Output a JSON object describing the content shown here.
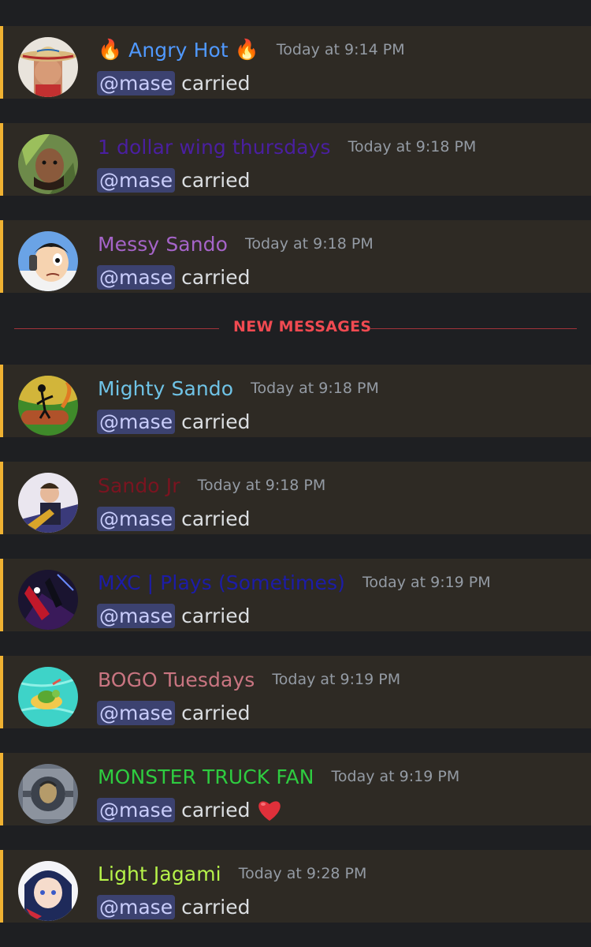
{
  "divider": {
    "label": "NEW MESSAGES"
  },
  "messages": [
    {
      "name": "Angry Hot",
      "name_color": "#5099ff",
      "prefix_emoji": "🔥",
      "suffix_emoji": "🔥",
      "timestamp": "Today at 9:14 PM",
      "mention": "@mase",
      "text": "carried",
      "avatar_icon": "cowboy-hat-avatar-icon"
    },
    {
      "name": "1 dollar wing thursdays",
      "name_color": "#4a1fa0",
      "timestamp": "Today at 9:18 PM",
      "mention": "@mase",
      "text": "carried",
      "avatar_icon": "upside-down-face-avatar-icon"
    },
    {
      "name": "Messy Sando",
      "name_color": "#a564c8",
      "timestamp": "Today at 9:18 PM",
      "mention": "@mase",
      "text": "carried",
      "avatar_icon": "cartoon-phone-avatar-icon"
    },
    {
      "name": "Mighty Sando",
      "name_color": "#6fc3e6",
      "timestamp": "Today at 9:18 PM",
      "mention": "@mase",
      "text": "carried",
      "avatar_icon": "jungle-stickman-avatar-icon"
    },
    {
      "name": "Sando Jr",
      "name_color": "#7a1420",
      "timestamp": "Today at 9:18 PM",
      "mention": "@mase",
      "text": "carried",
      "avatar_icon": "saxophone-avatar-icon"
    },
    {
      "name": "MXC | Plays (Sometimes)",
      "name_color": "#1c1ca8",
      "timestamp": "Today at 9:19 PM",
      "mention": "@mase",
      "text": "carried",
      "avatar_icon": "spider-hero-avatar-icon"
    },
    {
      "name": "BOGO Tuesdays",
      "name_color": "#c97581",
      "timestamp": "Today at 9:19 PM",
      "mention": "@mase",
      "text": "carried",
      "avatar_icon": "turtle-float-avatar-icon"
    },
    {
      "name": "MONSTER TRUCK FAN",
      "name_color": "#2ecc40",
      "timestamp": "Today at 9:19 PM",
      "mention": "@mase",
      "text": "carried",
      "trailing_icon": "red-heart-icon",
      "avatar_icon": "robot-pilot-avatar-icon"
    },
    {
      "name": "Light Jagami",
      "name_color": "#b6f34a",
      "timestamp": "Today at 9:28 PM",
      "mention": "@mase",
      "text": "carried",
      "avatar_icon": "anime-girl-avatar-icon"
    }
  ]
}
